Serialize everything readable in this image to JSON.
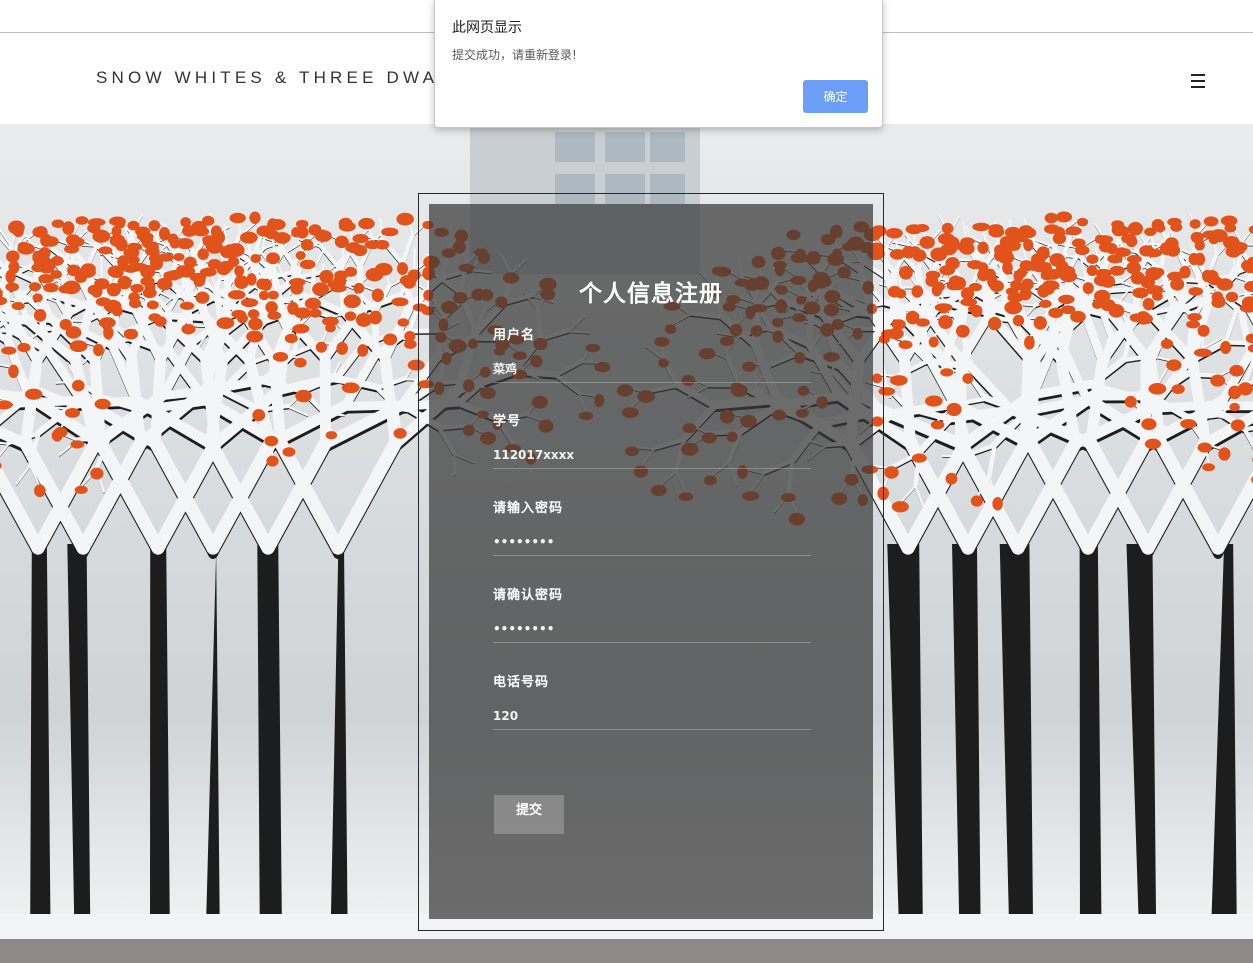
{
  "header": {
    "brand": "SNOW WHITES & THREE DWARFS",
    "menu_icon": "hamburger-menu-icon"
  },
  "background": {
    "description_icon": "snowy-persimmon-trees-photo",
    "colors": {
      "snow": "#f4f5f6",
      "branch": "#1d1d1d",
      "fruit": "#e2531c"
    }
  },
  "form": {
    "title": "个人信息注册",
    "fields": [
      {
        "label": "用户名",
        "value": "菜鸡"
      },
      {
        "label": "学号",
        "value": "112017xxxx"
      },
      {
        "label": "请输入密码",
        "value": "••••••••"
      },
      {
        "label": "请确认密码",
        "value": "••••••••"
      },
      {
        "label": "电话号码",
        "value": "120"
      }
    ],
    "submit_label": "提交"
  },
  "dialog": {
    "title": "此网页显示",
    "message": "提交成功，请重新登录!",
    "ok_label": "确定",
    "ok_color": "#6a9ef7"
  }
}
